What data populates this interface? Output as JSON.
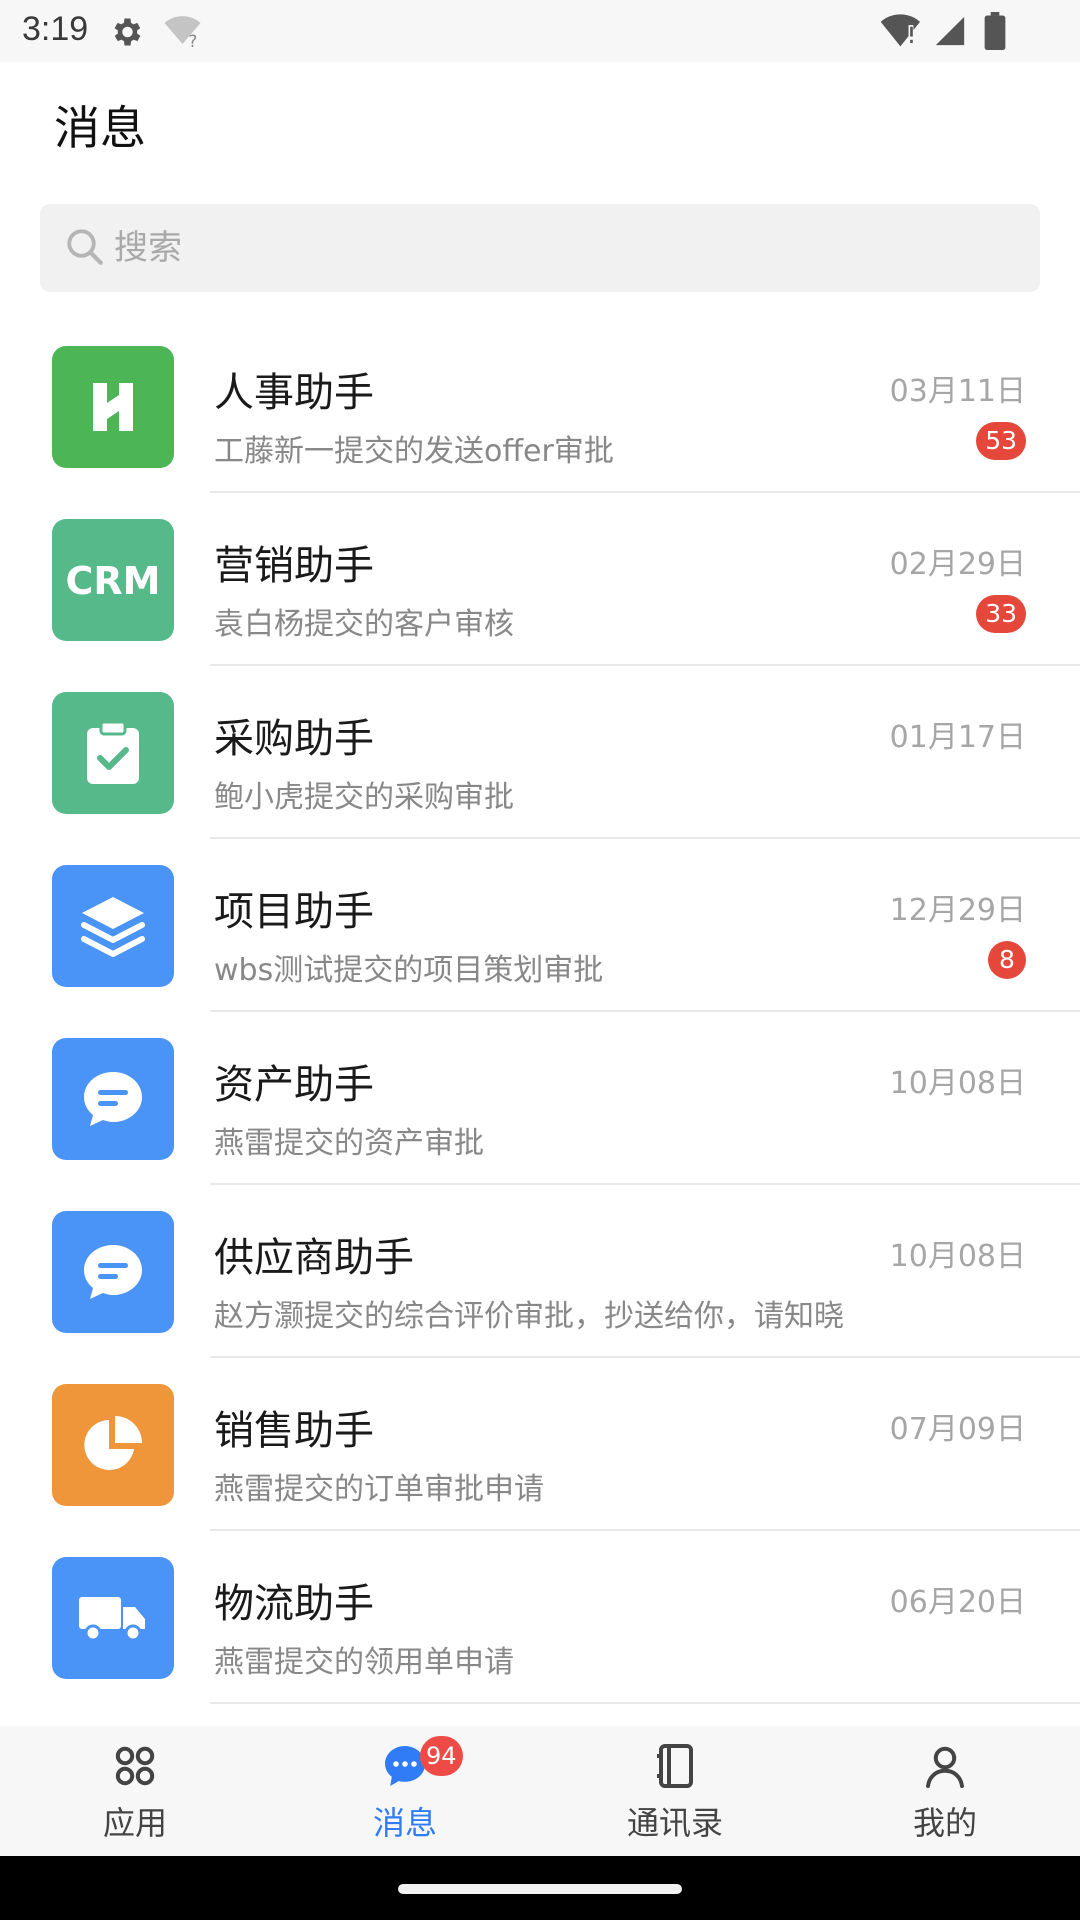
{
  "status_bar": {
    "time": "3:19"
  },
  "header": {
    "title": "消息"
  },
  "search": {
    "placeholder": "搜索"
  },
  "messages": [
    {
      "title": "人事助手",
      "subtitle": "工藤新一提交的发送offer审批",
      "date": "03月11日",
      "badge": "53",
      "icon": "hr-icon",
      "color": "#4cb657"
    },
    {
      "title": "营销助手",
      "subtitle": "袁白杨提交的客户审核",
      "date": "02月29日",
      "badge": "33",
      "icon": "crm-icon",
      "color": "#55b98a"
    },
    {
      "title": "采购助手",
      "subtitle": "鲍小虎提交的采购审批",
      "date": "01月17日",
      "badge": "",
      "icon": "clipboard-check-icon",
      "color": "#55b98a"
    },
    {
      "title": "项目助手",
      "subtitle": "wbs测试提交的项目策划审批",
      "date": "12月29日",
      "badge": "8",
      "icon": "layers-icon",
      "color": "#4a93f7"
    },
    {
      "title": "资产助手",
      "subtitle": "燕雷提交的资产审批",
      "date": "10月08日",
      "badge": "",
      "icon": "chat-bubble-icon",
      "color": "#4a93f7"
    },
    {
      "title": "供应商助手",
      "subtitle": "赵方灏提交的综合评价审批，抄送给你，请知晓",
      "date": "10月08日",
      "badge": "",
      "icon": "chat-bubble-icon",
      "color": "#4a93f7"
    },
    {
      "title": "销售助手",
      "subtitle": "燕雷提交的订单审批申请",
      "date": "07月09日",
      "badge": "",
      "icon": "pie-chart-icon",
      "color": "#ef963b"
    },
    {
      "title": "物流助手",
      "subtitle": "燕雷提交的领用单申请",
      "date": "06月20日",
      "badge": "",
      "icon": "truck-icon",
      "color": "#4a93f7"
    }
  ],
  "bottom_nav": {
    "items": [
      {
        "label": "应用",
        "icon": "apps-grid-icon"
      },
      {
        "label": "消息",
        "icon": "message-icon",
        "badge": "94",
        "active": true
      },
      {
        "label": "通讯录",
        "icon": "contacts-book-icon"
      },
      {
        "label": "我的",
        "icon": "person-icon"
      }
    ]
  },
  "colors": {
    "accent": "#2f7cf6",
    "badge": "#e5483b"
  }
}
